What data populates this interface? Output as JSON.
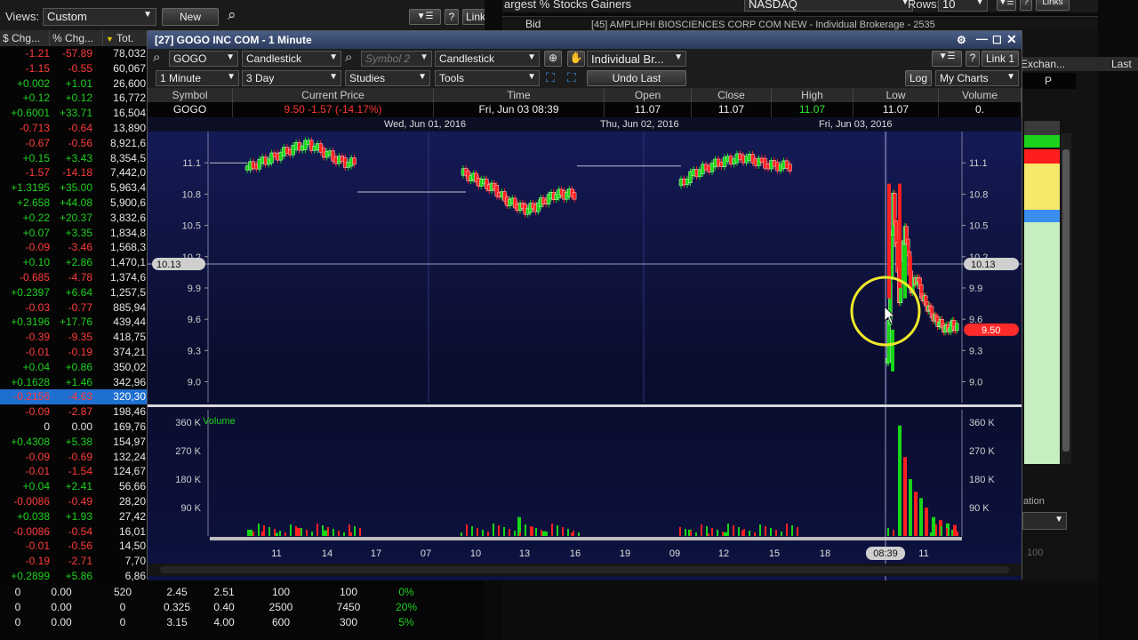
{
  "watchlist": {
    "views_label": "Views:",
    "views_value": "Custom",
    "new_label": "New",
    "link_label": "Link 1",
    "help_label": "?",
    "columns": [
      "$ Chg...",
      "% Chg...",
      "Tot."
    ],
    "rows": [
      [
        "-1.21",
        "-57.89",
        "78,032",
        "r"
      ],
      [
        "-1.15",
        "-0.55",
        "60,067",
        "r"
      ],
      [
        "+0.002",
        "+1.01",
        "26,600",
        "g"
      ],
      [
        "+0.12",
        "+0.12",
        "16,772",
        "g"
      ],
      [
        "+0.6001",
        "+33.71",
        "16,504",
        "g"
      ],
      [
        "-0.713",
        "-0.64",
        "13,890",
        "r"
      ],
      [
        "-0.67",
        "-0.56",
        "8,921,6",
        "r"
      ],
      [
        "+0.15",
        "+3.43",
        "8,354,5",
        "g"
      ],
      [
        "-1.57",
        "-14.18",
        "7,442,0",
        "r"
      ],
      [
        "+1.3195",
        "+35.00",
        "5,963,4",
        "g"
      ],
      [
        "+2.658",
        "+44.08",
        "5,900,6",
        "g"
      ],
      [
        "+0.22",
        "+20.37",
        "3,832,6",
        "g"
      ],
      [
        "+0.07",
        "+3.35",
        "1,834,8",
        "g"
      ],
      [
        "-0.09",
        "-3.46",
        "1,568,3",
        "r"
      ],
      [
        "+0.10",
        "+2.86",
        "1,470,1",
        "g"
      ],
      [
        "-0.685",
        "-4.78",
        "1,374,6",
        "r"
      ],
      [
        "+0.2397",
        "+6.64",
        "1,257,5",
        "g"
      ],
      [
        "-0.03",
        "-0.77",
        "885,94",
        "r"
      ],
      [
        "+0.3196",
        "+17.76",
        "439,44",
        "g"
      ],
      [
        "-0.39",
        "-9.35",
        "418,75",
        "r"
      ],
      [
        "-0.01",
        "-0.19",
        "374,21",
        "r"
      ],
      [
        "+0.04",
        "+0.86",
        "350,02",
        "g"
      ],
      [
        "+0.1628",
        "+1.46",
        "342,96",
        "g"
      ],
      [
        "-0.2156",
        "-4.63",
        "320,30",
        "sel"
      ],
      [
        "-0.09",
        "-2.87",
        "198,46",
        "r"
      ],
      [
        "0",
        "0.00",
        "169,76",
        "w"
      ],
      [
        "+0.4308",
        "+5.38",
        "154,97",
        "g"
      ],
      [
        "-0.09",
        "-0.69",
        "132,24",
        "r"
      ],
      [
        "-0.01",
        "-1.54",
        "124,67",
        "r"
      ],
      [
        "+0.04",
        "+2.41",
        "56,66",
        "g"
      ],
      [
        "-0.0086",
        "-0.49",
        "28,20",
        "r"
      ],
      [
        "+0.038",
        "+1.93",
        "27,42",
        "g"
      ],
      [
        "-0.0086",
        "-0.54",
        "16,01",
        "r"
      ],
      [
        "-0.01",
        "-0.56",
        "14,50",
        "r"
      ],
      [
        "-0.19",
        "-2.71",
        "7,70",
        "r"
      ],
      [
        "+0.2899",
        "+5.86",
        "6,86",
        "g"
      ]
    ],
    "bottom_rows": [
      [
        "0",
        "0.00",
        "520",
        "2.45",
        "2.51",
        "100",
        "100",
        "0%"
      ],
      [
        "0",
        "0.00",
        "0",
        "0.325",
        "0.40",
        "2500",
        "7450",
        "20%"
      ],
      [
        "0",
        "0.00",
        "0",
        "3.15",
        "4.00",
        "600",
        "300",
        "5%"
      ]
    ]
  },
  "background": {
    "gainers_title": "argest % Stocks Gainers",
    "exchange": "NASDAQ",
    "rows_label": "Rows:",
    "rows_value": "10",
    "links_label": "Links",
    "bid_label": "Bid",
    "news_text": "[45] AMPLIPHI BIOSCIENCES CORP COM NEW - Individual Brokerage - 2535",
    "col_exchange": "Exchan...",
    "col_last": "Last",
    "p_value": "P",
    "ation_label": "ation",
    "val_100": "100"
  },
  "chart": {
    "title": "[27] GOGO INC COM - 1 Minute",
    "symbol": "GOGO",
    "chart_type": "Candlestick",
    "symbol2_placeholder": "Symbol 2",
    "chart_type2": "Candlestick",
    "account": "Individual Br...",
    "link_label": "Link 1",
    "interval": "1 Minute",
    "range": "3 Day",
    "studies": "Studies",
    "tools": "Tools",
    "undo": "Undo Last",
    "log": "Log",
    "my_charts": "My Charts",
    "quote_headers": [
      "Symbol",
      "Current Price",
      "Time",
      "Open",
      "Close",
      "High",
      "Low",
      "Volume"
    ],
    "quote_values": {
      "symbol": "GOGO",
      "price": "9.50  -1.57 (-14.17%)",
      "time": "Fri, Jun 03  08:39",
      "open": "11.07",
      "close": "11.07",
      "high": "11.07",
      "low": "11.07",
      "volume": "0."
    },
    "day_labels": [
      "Wed, Jun 01, 2016",
      "Thu, Jun 02, 2016",
      "Fri, Jun 03, 2016"
    ],
    "y_ticks": [
      "11.1",
      "10.8",
      "10.5",
      "10.2",
      "9.9",
      "9.6",
      "9.3",
      "9.0"
    ],
    "crosshair_left": "10.13",
    "crosshair_right": "10.13",
    "last_price_tag": "9.50",
    "volume_label": "Volume",
    "vol_ticks": [
      "360 K",
      "270 K",
      "180 K",
      "90 K"
    ],
    "x_ticks": [
      "11",
      "14",
      "17",
      "07",
      "10",
      "13",
      "16",
      "19",
      "09",
      "12",
      "15",
      "18",
      "11"
    ],
    "time_tag": "08:39",
    "colors": {
      "up": "#17d617",
      "down": "#ff2020",
      "panel_top": "#141a55"
    }
  },
  "chart_data": {
    "type": "candlestick",
    "title": "[27] GOGO INC COM - 1 Minute",
    "price_ylim": [
      8.8,
      11.4
    ],
    "volume_ylim": [
      0,
      400000
    ],
    "y_ticks": [
      9.0,
      9.3,
      9.6,
      9.9,
      10.2,
      10.5,
      10.8,
      11.1
    ],
    "day_labels": [
      "Wed, Jun 01, 2016",
      "Thu, Jun 02, 2016",
      "Fri, Jun 03, 2016"
    ],
    "x_ticks": [
      "11",
      "14",
      "17",
      "07",
      "10",
      "13",
      "16",
      "19",
      "09",
      "12",
      "15",
      "18",
      "08:39",
      "11"
    ],
    "crosshair_price": 10.13,
    "last_price": 9.5,
    "segments": [
      {
        "day": "Wed, Jun 01, 2016",
        "price_path": [
          11.05,
          11.1,
          11.15,
          11.2,
          11.25,
          11.28,
          11.22,
          11.15,
          11.1,
          11.1
        ],
        "after_hours": 11.1
      },
      {
        "day": "Thu, Jun 02, 2016",
        "price_path": [
          11.0,
          10.95,
          10.9,
          10.85,
          10.75,
          10.7,
          10.65,
          10.68,
          10.75,
          10.8,
          10.8,
          10.8
        ],
        "after_hours": 10.82
      },
      {
        "day": "Fri, Jun 03, 2016",
        "price_path": [
          10.9,
          11.0,
          11.05,
          11.1,
          11.13,
          11.15,
          11.12,
          11.08,
          11.07,
          11.07
        ],
        "after_hours": 11.07
      },
      {
        "day": "Fri, Jun 03, 2016 (session)",
        "price_path": [
          9.2,
          10.8,
          9.8,
          10.5,
          9.9,
          10.0,
          9.8,
          9.7,
          9.6,
          9.55,
          9.5,
          9.55,
          9.5
        ],
        "note": "sharp gap down at 08:39"
      }
    ],
    "volume_spikes_k": [
      20,
      15,
      10,
      25,
      18,
      12,
      60,
      30,
      15,
      10,
      20,
      8,
      12,
      18,
      350,
      250,
      180,
      140,
      120,
      90,
      60,
      50,
      40,
      35
    ]
  }
}
